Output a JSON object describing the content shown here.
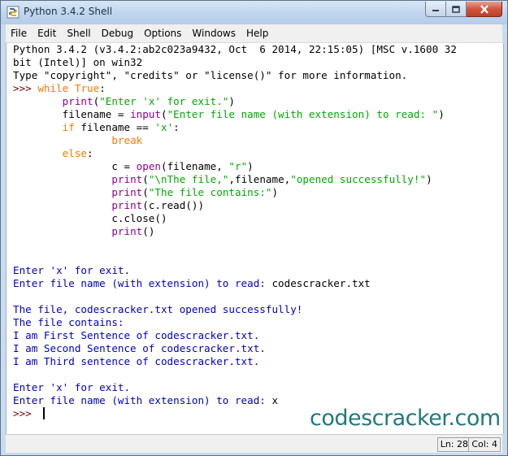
{
  "window": {
    "title": "Python 3.4.2 Shell",
    "controls": {
      "minimize": "minimize",
      "maximize": "maximize",
      "close": "close"
    }
  },
  "menu": [
    "File",
    "Edit",
    "Shell",
    "Debug",
    "Options",
    "Windows",
    "Help"
  ],
  "shell": {
    "lines": [
      [
        {
          "t": "Python 3.4.2 (v3.4.2:ab2c023a9432, Oct  6 2014, 22:15:05) [MSC v.1600 32",
          "c": "txt"
        }
      ],
      [
        {
          "t": "bit (Intel)] on win32",
          "c": "txt"
        }
      ],
      [
        {
          "t": "Type \"copyright\", \"credits\" or \"license()\" for more information.",
          "c": "txt"
        }
      ],
      [
        {
          "t": ">>> ",
          "c": "pr"
        },
        {
          "t": "while",
          "c": "kw"
        },
        {
          "t": " ",
          "c": "txt"
        },
        {
          "t": "True",
          "c": "kw"
        },
        {
          "t": ":",
          "c": "txt"
        }
      ],
      [
        {
          "t": "        ",
          "c": "txt"
        },
        {
          "t": "print",
          "c": "bi"
        },
        {
          "t": "(",
          "c": "txt"
        },
        {
          "t": "\"Enter 'x' for exit.\"",
          "c": "st"
        },
        {
          "t": ")",
          "c": "txt"
        }
      ],
      [
        {
          "t": "        filename = ",
          "c": "txt"
        },
        {
          "t": "input",
          "c": "bi"
        },
        {
          "t": "(",
          "c": "txt"
        },
        {
          "t": "\"Enter file name (with extension) to read: \"",
          "c": "st"
        },
        {
          "t": ")",
          "c": "txt"
        }
      ],
      [
        {
          "t": "        ",
          "c": "txt"
        },
        {
          "t": "if",
          "c": "kw"
        },
        {
          "t": " filename == ",
          "c": "txt"
        },
        {
          "t": "'x'",
          "c": "st"
        },
        {
          "t": ":",
          "c": "txt"
        }
      ],
      [
        {
          "t": "                ",
          "c": "txt"
        },
        {
          "t": "break",
          "c": "kw"
        }
      ],
      [
        {
          "t": "        ",
          "c": "txt"
        },
        {
          "t": "else",
          "c": "kw"
        },
        {
          "t": ":",
          "c": "txt"
        }
      ],
      [
        {
          "t": "                c = ",
          "c": "txt"
        },
        {
          "t": "open",
          "c": "bi"
        },
        {
          "t": "(filename, ",
          "c": "txt"
        },
        {
          "t": "\"r\"",
          "c": "st"
        },
        {
          "t": ")",
          "c": "txt"
        }
      ],
      [
        {
          "t": "                ",
          "c": "txt"
        },
        {
          "t": "print",
          "c": "bi"
        },
        {
          "t": "(",
          "c": "txt"
        },
        {
          "t": "\"\\nThe file,\"",
          "c": "st"
        },
        {
          "t": ",filename,",
          "c": "txt"
        },
        {
          "t": "\"opened successfully!\"",
          "c": "st"
        },
        {
          "t": ")",
          "c": "txt"
        }
      ],
      [
        {
          "t": "                ",
          "c": "txt"
        },
        {
          "t": "print",
          "c": "bi"
        },
        {
          "t": "(",
          "c": "txt"
        },
        {
          "t": "\"The file contains:\"",
          "c": "st"
        },
        {
          "t": ")",
          "c": "txt"
        }
      ],
      [
        {
          "t": "                ",
          "c": "txt"
        },
        {
          "t": "print",
          "c": "bi"
        },
        {
          "t": "(c.read())",
          "c": "txt"
        }
      ],
      [
        {
          "t": "                c.close()",
          "c": "txt"
        }
      ],
      [
        {
          "t": "                ",
          "c": "txt"
        },
        {
          "t": "print",
          "c": "bi"
        },
        {
          "t": "()",
          "c": "txt"
        }
      ],
      [],
      [],
      [
        {
          "t": "Enter 'x' for exit.",
          "c": "out"
        }
      ],
      [
        {
          "t": "Enter file name (with extension) to read: ",
          "c": "out"
        },
        {
          "t": "codescracker.txt",
          "c": "txt"
        }
      ],
      [],
      [
        {
          "t": "The file, codescracker.txt opened successfully!",
          "c": "out"
        }
      ],
      [
        {
          "t": "The file contains:",
          "c": "out"
        }
      ],
      [
        {
          "t": "I am First Sentence of codescracker.txt.",
          "c": "out"
        }
      ],
      [
        {
          "t": "I am Second Sentence of codescracker.txt.",
          "c": "out"
        }
      ],
      [
        {
          "t": "I am Third sentence of codescracker.txt.",
          "c": "out"
        }
      ],
      [],
      [
        {
          "t": "Enter 'x' for exit.",
          "c": "out"
        }
      ],
      [
        {
          "t": "Enter file name (with extension) to read: ",
          "c": "out"
        },
        {
          "t": "x",
          "c": "txt"
        }
      ],
      [
        {
          "t": ">>> ",
          "c": "pr"
        }
      ]
    ]
  },
  "watermark": "codescracker.com",
  "status": {
    "line": "Ln: 28",
    "col": "Col: 4"
  },
  "colors": {
    "keyword": "#ff7700",
    "builtin": "#900090",
    "string": "#00aa00",
    "prompt": "#7f0000",
    "stdout": "#0000c0",
    "watermark": "#20797c"
  }
}
